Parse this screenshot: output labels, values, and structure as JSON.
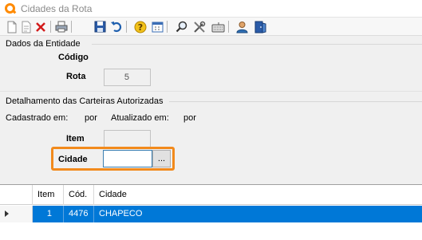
{
  "window": {
    "title": "Cidades da Rota"
  },
  "toolbar": {
    "icons": [
      "new-document-icon",
      "edit-document-icon",
      "delete-icon",
      "print-icon",
      "save-icon",
      "undo-icon",
      "help-icon",
      "calendar-icon",
      "search-icon",
      "tools-icon",
      "keyboard-icon",
      "user-icon",
      "exit-icon"
    ]
  },
  "entity": {
    "section_title": "Dados da Entidade",
    "codigo_label": "Código",
    "rota_label": "Rota",
    "rota_value": "5"
  },
  "details": {
    "section_title": "Detalhamento das Carteiras Autorizadas",
    "cadastrado_label": "Cadastrado em:",
    "por_label_1": "por",
    "atualizado_label": "Atualizado em:",
    "por_label_2": "por",
    "item_label": "Item",
    "item_value": "",
    "cidade_label": "Cidade",
    "cidade_value": "",
    "lookup_button": "..."
  },
  "grid": {
    "columns": [
      "Item",
      "Cód.",
      "Cidade"
    ],
    "rows": [
      {
        "item": "1",
        "cod": "4476",
        "cidade": "CHAPECO"
      }
    ]
  },
  "colors": {
    "highlight": "#f28a1c",
    "selection": "#0078d7",
    "accent_icon": "#ff8a00"
  }
}
